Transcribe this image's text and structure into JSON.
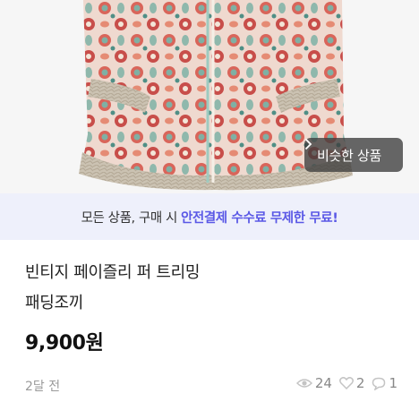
{
  "product": {
    "title_line1": "빈티지 페이즐리 퍼 트리밍",
    "title_line2": "패딩조끼",
    "price": "9,900원",
    "posted": "2달 전",
    "views": "24",
    "likes": "2",
    "chats": "1"
  },
  "image": {
    "similar_button_label": "비슷한 상품",
    "similar_button_icon": "chevron-right-icon"
  },
  "banner": {
    "text_plain": "모든 상품, 구매 시",
    "text_highlight": "안전결제 수수료 무제한 무료!"
  },
  "colors": {
    "accent": "#5a58e6",
    "banner_bg": "#eef0fb",
    "pattern_red": "#d9655a",
    "pattern_teal": "#7fb0a4",
    "fur": "#c9bfae"
  }
}
